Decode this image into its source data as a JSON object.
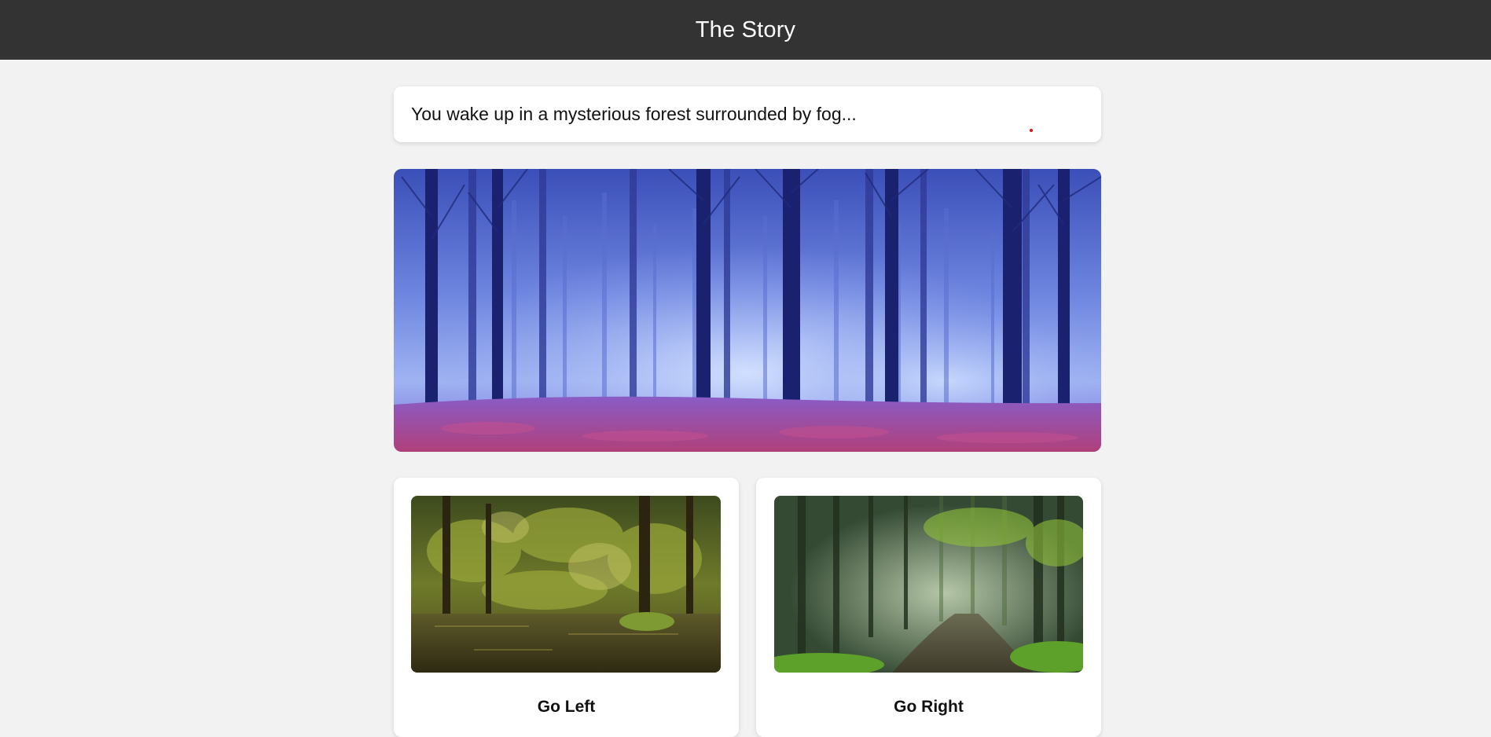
{
  "header": {
    "title": "The Story"
  },
  "story": {
    "text": "You wake up in a mysterious forest surrounded by fog..."
  },
  "choices": [
    {
      "label": "Go Left"
    },
    {
      "label": "Go Right"
    }
  ],
  "colors": {
    "header_bg": "#333333",
    "page_bg": "#f2f2f2",
    "card_bg": "#ffffff"
  }
}
